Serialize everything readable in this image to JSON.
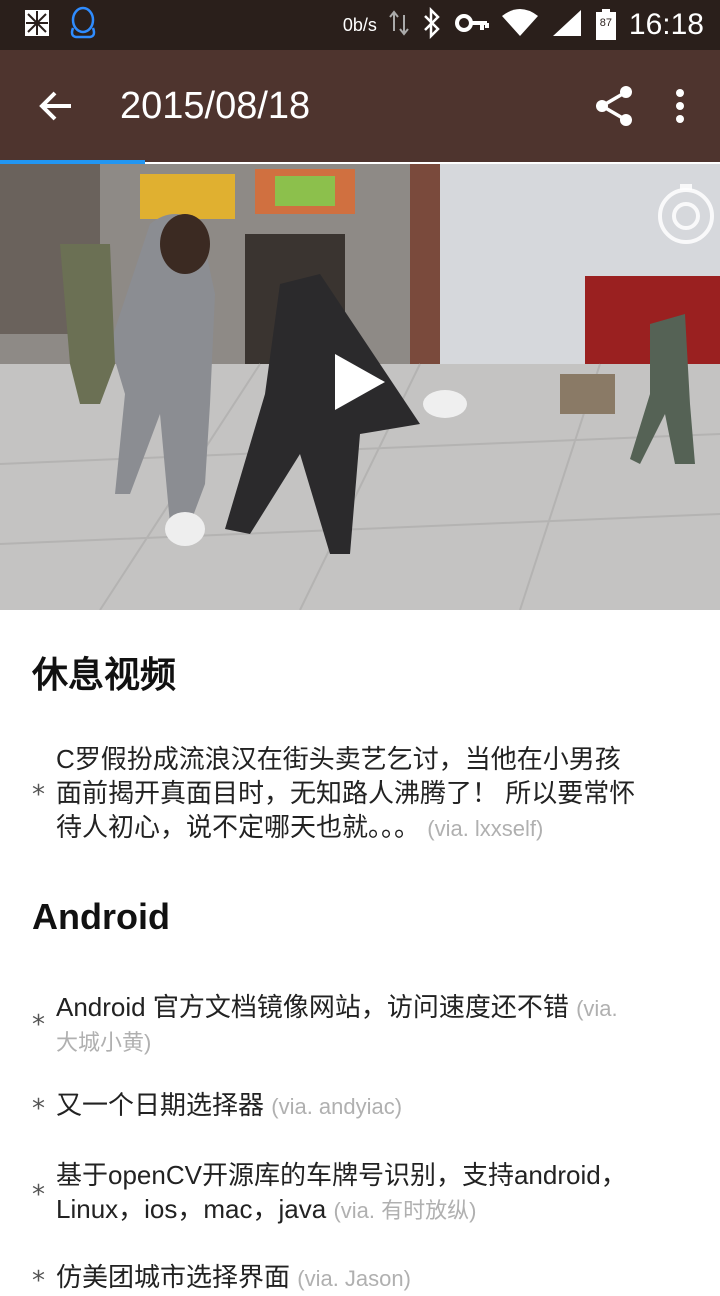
{
  "status_bar": {
    "net_speed": "0b/s",
    "battery": "87",
    "time": "16:18"
  },
  "app_bar": {
    "title": "2015/08/18",
    "back_icon": "arrow-back-icon",
    "share_icon": "share-icon",
    "more_icon": "more-vert-icon"
  },
  "video": {
    "play_icon": "play-icon",
    "record_icon": "record-icon"
  },
  "sections": [
    {
      "title": "休息视频",
      "items": [
        {
          "lines": [
            "C罗假扮成流浪汉在街头卖艺乞讨，当他在小男孩",
            "面前揭开真面目时，无知路人沸腾了！ 所以要常怀",
            "待人初心，说不定哪天也就。。。"
          ],
          "via": "(via. lxxself)"
        }
      ]
    },
    {
      "title": "Android",
      "items": [
        {
          "lines": [
            "Android 官方文档镜像网站，访问速度还不错"
          ],
          "via": "(via.",
          "via2": "大城小黄)"
        },
        {
          "lines": [
            "又一个日期选择器"
          ],
          "via": "(via. andyiac)"
        },
        {
          "lines": [
            "基于openCV开源库的车牌号识别，支持android，",
            "Linux，ios，mac，java"
          ],
          "via": "(via. 有时放纵)"
        },
        {
          "lines": [
            "仿美团城市选择界面"
          ],
          "via": "(via. Jason)"
        }
      ]
    }
  ]
}
